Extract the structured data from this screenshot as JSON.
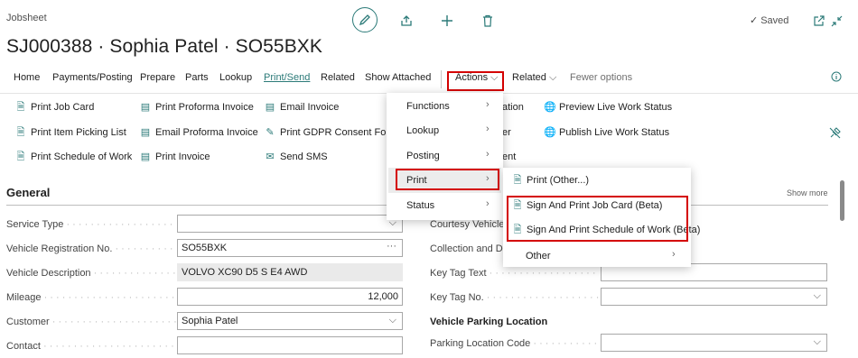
{
  "header": {
    "caption": "Jobsheet",
    "title": "SJ000388 · Sophia Patel · SO55BXK",
    "saved_label": "Saved"
  },
  "menu": {
    "items": [
      "Home",
      "Payments/Posting",
      "Prepare",
      "Parts",
      "Lookup",
      "Print/Send",
      "Related",
      "Show Attached"
    ],
    "actions": "Actions",
    "related": "Related",
    "fewer_options": "Fewer options"
  },
  "actions_col1": [
    "Print Job Card",
    "Print Item Picking List",
    "Print Schedule of Work"
  ],
  "actions_col2": [
    "Print Proforma Invoice",
    "Email Proforma Invoice",
    "Print Invoice"
  ],
  "actions_col3": [
    "Email Invoice",
    "Print GDPR Consent Form",
    "Send SMS"
  ],
  "actions_col4_partial": [
    "ation",
    "er",
    "ent"
  ],
  "actions_col5": [
    "Preview Live Work Status",
    "Publish Live Work Status"
  ],
  "general": {
    "heading": "General",
    "show_more": "Show more"
  },
  "left_fields": [
    {
      "label": "Service Type",
      "value": ""
    },
    {
      "label": "Vehicle Registration No.",
      "value": "SO55BXK"
    },
    {
      "label": "Vehicle Description",
      "value": "VOLVO XC90 D5 S E4 AWD"
    },
    {
      "label": "Mileage",
      "value": "12,000"
    },
    {
      "label": "Customer",
      "value": "Sophia Patel"
    },
    {
      "label": "Contact",
      "value": ""
    }
  ],
  "right_fields": [
    {
      "label": "Courtesy Vehicle R"
    },
    {
      "label": "Collection and Del"
    },
    {
      "label": "Key Tag Text"
    },
    {
      "label": "Key Tag No."
    },
    {
      "label": "Vehicle Parking Location"
    },
    {
      "label": "Parking Location Code"
    }
  ],
  "actions_menu": [
    "Functions",
    "Lookup",
    "Posting",
    "Print",
    "Status"
  ],
  "print_submenu": {
    "other": "Print (Other...)",
    "job_card": "Sign And Print Job Card (Beta)",
    "schedule": "Sign And Print Schedule of Work (Beta)",
    "more": "Other"
  },
  "colors": {
    "accent": "#2b7a78",
    "highlight": "#d40000"
  }
}
